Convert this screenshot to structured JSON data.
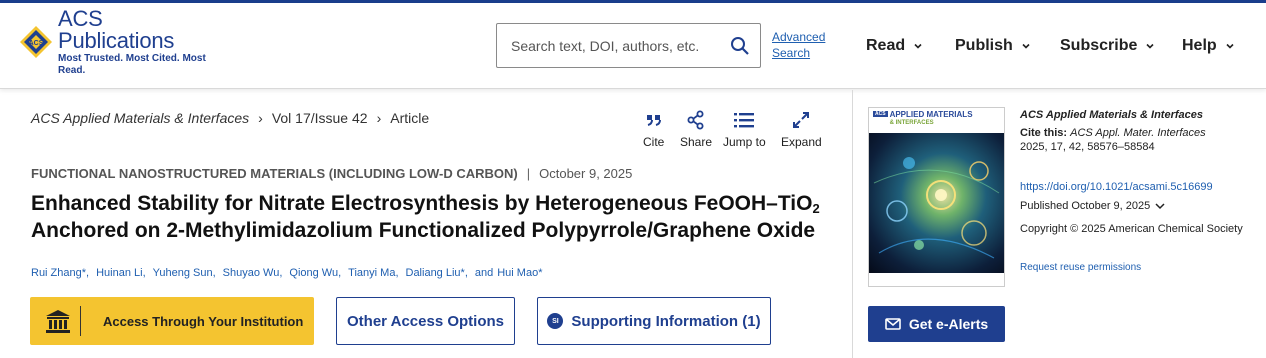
{
  "brand": {
    "name": "ACS Publications",
    "tagline": "Most Trusted. Most Cited. Most Read.",
    "color": "#1f3f8f",
    "accent": "#f4c430"
  },
  "search": {
    "placeholder": "Search text, DOI, authors, etc.",
    "advanced_line1": "Advanced",
    "advanced_line2": "Search"
  },
  "nav": {
    "items": [
      {
        "label": "Read"
      },
      {
        "label": "Publish"
      },
      {
        "label": "Subscribe"
      },
      {
        "label": "Help"
      }
    ]
  },
  "breadcrumb": {
    "journal": "ACS Applied Materials & Interfaces",
    "issue": "Vol 17/Issue 42",
    "page": "Article"
  },
  "tools": {
    "cite": "Cite",
    "share": "Share",
    "jump": "Jump to",
    "expand": "Expand"
  },
  "article": {
    "section": "FUNCTIONAL NANOSTRUCTURED MATERIALS (INCLUDING LOW-D CARBON)",
    "date": "October 9, 2025",
    "title_part1": "Enhanced Stability for Nitrate Electrosynthesis by Heterogeneous FeOOH–TiO",
    "title_sub": "2",
    "title_part2": " Anchored on 2-Methylimidazolium Functionalized Polypyrrole/Graphene Oxide",
    "authors": [
      "Rui Zhang*,",
      "Huinan Li,",
      "Yuheng Sun,",
      "Shuyao Wu,",
      "Qiong Wu,",
      "Tianyi Ma,",
      "Daliang Liu*,"
    ],
    "authors_and": "and",
    "last_author": "Hui Mao*"
  },
  "buttons": {
    "institution": "Access Through Your Institution",
    "other": "Other Access Options",
    "si_badge": "SI",
    "supporting": "Supporting Information (1)",
    "alerts": "Get e-Alerts"
  },
  "cover": {
    "badge": "ACS",
    "title_line1": "APPLIED MATERIALS",
    "title_line2": "& INTERFACES"
  },
  "sidebar": {
    "journal": "ACS Applied Materials & Interfaces",
    "cite_label": "Cite this:",
    "cite_journal": "ACS Appl. Mater. Interfaces",
    "cite_ref": "2025, 17, 42, 58576–58584",
    "doi": "https://doi.org/10.1021/acsami.5c16699",
    "published": "Published October 9, 2025",
    "copyright": "Copyright © 2025 American Chemical Society",
    "reuse": "Request reuse permissions"
  }
}
